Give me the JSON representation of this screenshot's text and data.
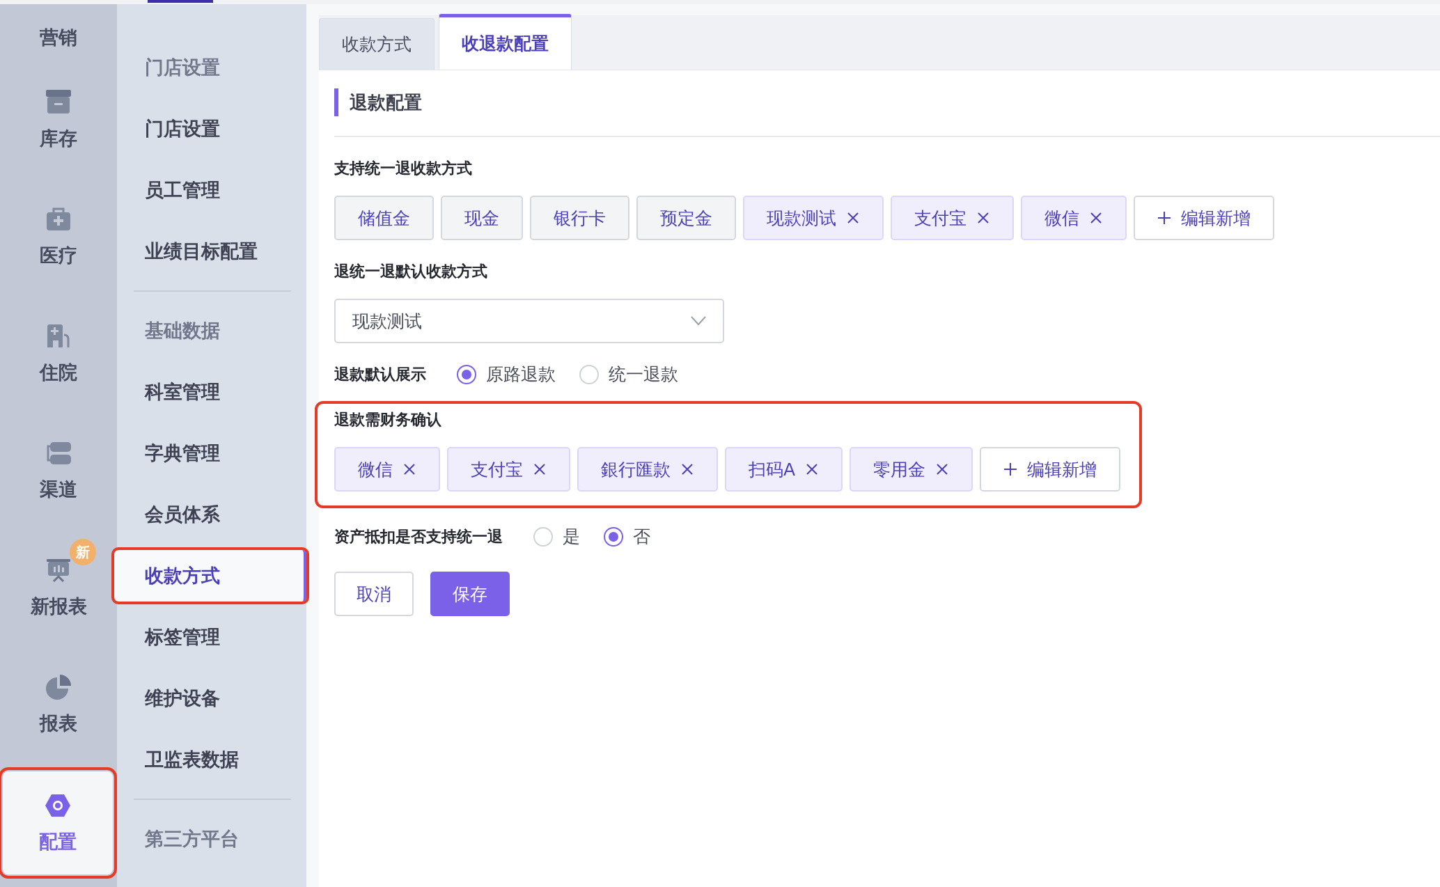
{
  "rail": {
    "items": [
      {
        "label": "营销",
        "selected": false,
        "highlighted": false
      },
      {
        "label": "库存",
        "selected": false,
        "highlighted": false
      },
      {
        "label": "医疗",
        "selected": false,
        "highlighted": false
      },
      {
        "label": "住院",
        "selected": false,
        "highlighted": false
      },
      {
        "label": "渠道",
        "selected": false,
        "highlighted": false
      },
      {
        "label": "新报表",
        "badge": "新",
        "selected": false,
        "highlighted": false
      },
      {
        "label": "报表",
        "selected": false,
        "highlighted": false
      },
      {
        "label": "配置",
        "selected": true,
        "highlighted": true
      }
    ]
  },
  "menu": {
    "groups": [
      [
        {
          "label": "门店设置",
          "kind": "header",
          "selected": false,
          "highlighted": false
        },
        {
          "label": "门店设置",
          "kind": "item",
          "selected": false,
          "highlighted": false
        },
        {
          "label": "员工管理",
          "kind": "item",
          "selected": false,
          "highlighted": false
        },
        {
          "label": "业绩目标配置",
          "kind": "item",
          "selected": false,
          "highlighted": false
        }
      ],
      [
        {
          "label": "基础数据",
          "kind": "header",
          "selected": false,
          "highlighted": false
        },
        {
          "label": "科室管理",
          "kind": "item",
          "selected": false,
          "highlighted": false
        },
        {
          "label": "字典管理",
          "kind": "item",
          "selected": false,
          "highlighted": false
        },
        {
          "label": "会员体系",
          "kind": "item",
          "selected": false,
          "highlighted": false
        },
        {
          "label": "收款方式",
          "kind": "item",
          "selected": true,
          "highlighted": true
        },
        {
          "label": "标签管理",
          "kind": "item",
          "selected": false,
          "highlighted": false
        },
        {
          "label": "维护设备",
          "kind": "item",
          "selected": false,
          "highlighted": false
        },
        {
          "label": "卫监表数据",
          "kind": "item",
          "selected": false,
          "highlighted": false
        }
      ],
      [
        {
          "label": "第三方平台",
          "kind": "header",
          "selected": false,
          "highlighted": false
        }
      ]
    ]
  },
  "tabs": [
    {
      "label": "收款方式",
      "selected": false
    },
    {
      "label": "收退款配置",
      "selected": true
    }
  ],
  "section_title": "退款配置",
  "support_methods": {
    "label": "支持统一退收款方式",
    "tags": [
      {
        "label": "储值金",
        "kind": "fixed"
      },
      {
        "label": "现金",
        "kind": "fixed"
      },
      {
        "label": "银行卡",
        "kind": "fixed"
      },
      {
        "label": "预定金",
        "kind": "fixed"
      },
      {
        "label": "现款测试",
        "kind": "removable"
      },
      {
        "label": "支付宝",
        "kind": "removable"
      },
      {
        "label": "微信",
        "kind": "removable"
      },
      {
        "label": "编辑新增",
        "kind": "add"
      }
    ]
  },
  "default_method": {
    "label": "退统一退默认收款方式",
    "value": "现款测试"
  },
  "refund_display": {
    "label": "退款默认展示",
    "options": [
      {
        "label": "原路退款",
        "selected": true
      },
      {
        "label": "统一退款",
        "selected": false
      }
    ]
  },
  "finance_confirm": {
    "label": "退款需财务确认",
    "highlighted": true,
    "tags": [
      {
        "label": "微信",
        "kind": "removable"
      },
      {
        "label": "支付宝",
        "kind": "removable"
      },
      {
        "label": "銀行匯款",
        "kind": "removable"
      },
      {
        "label": "扫码A",
        "kind": "removable"
      },
      {
        "label": "零用金",
        "kind": "removable"
      },
      {
        "label": "编辑新增",
        "kind": "add"
      }
    ]
  },
  "asset_deduction": {
    "label": "资产抵扣是否支持统一退",
    "options": [
      {
        "label": "是",
        "selected": false
      },
      {
        "label": "否",
        "selected": true
      }
    ]
  },
  "buttons": [
    {
      "label": "取消",
      "kind": "secondary"
    },
    {
      "label": "保存",
      "kind": "primary"
    }
  ]
}
